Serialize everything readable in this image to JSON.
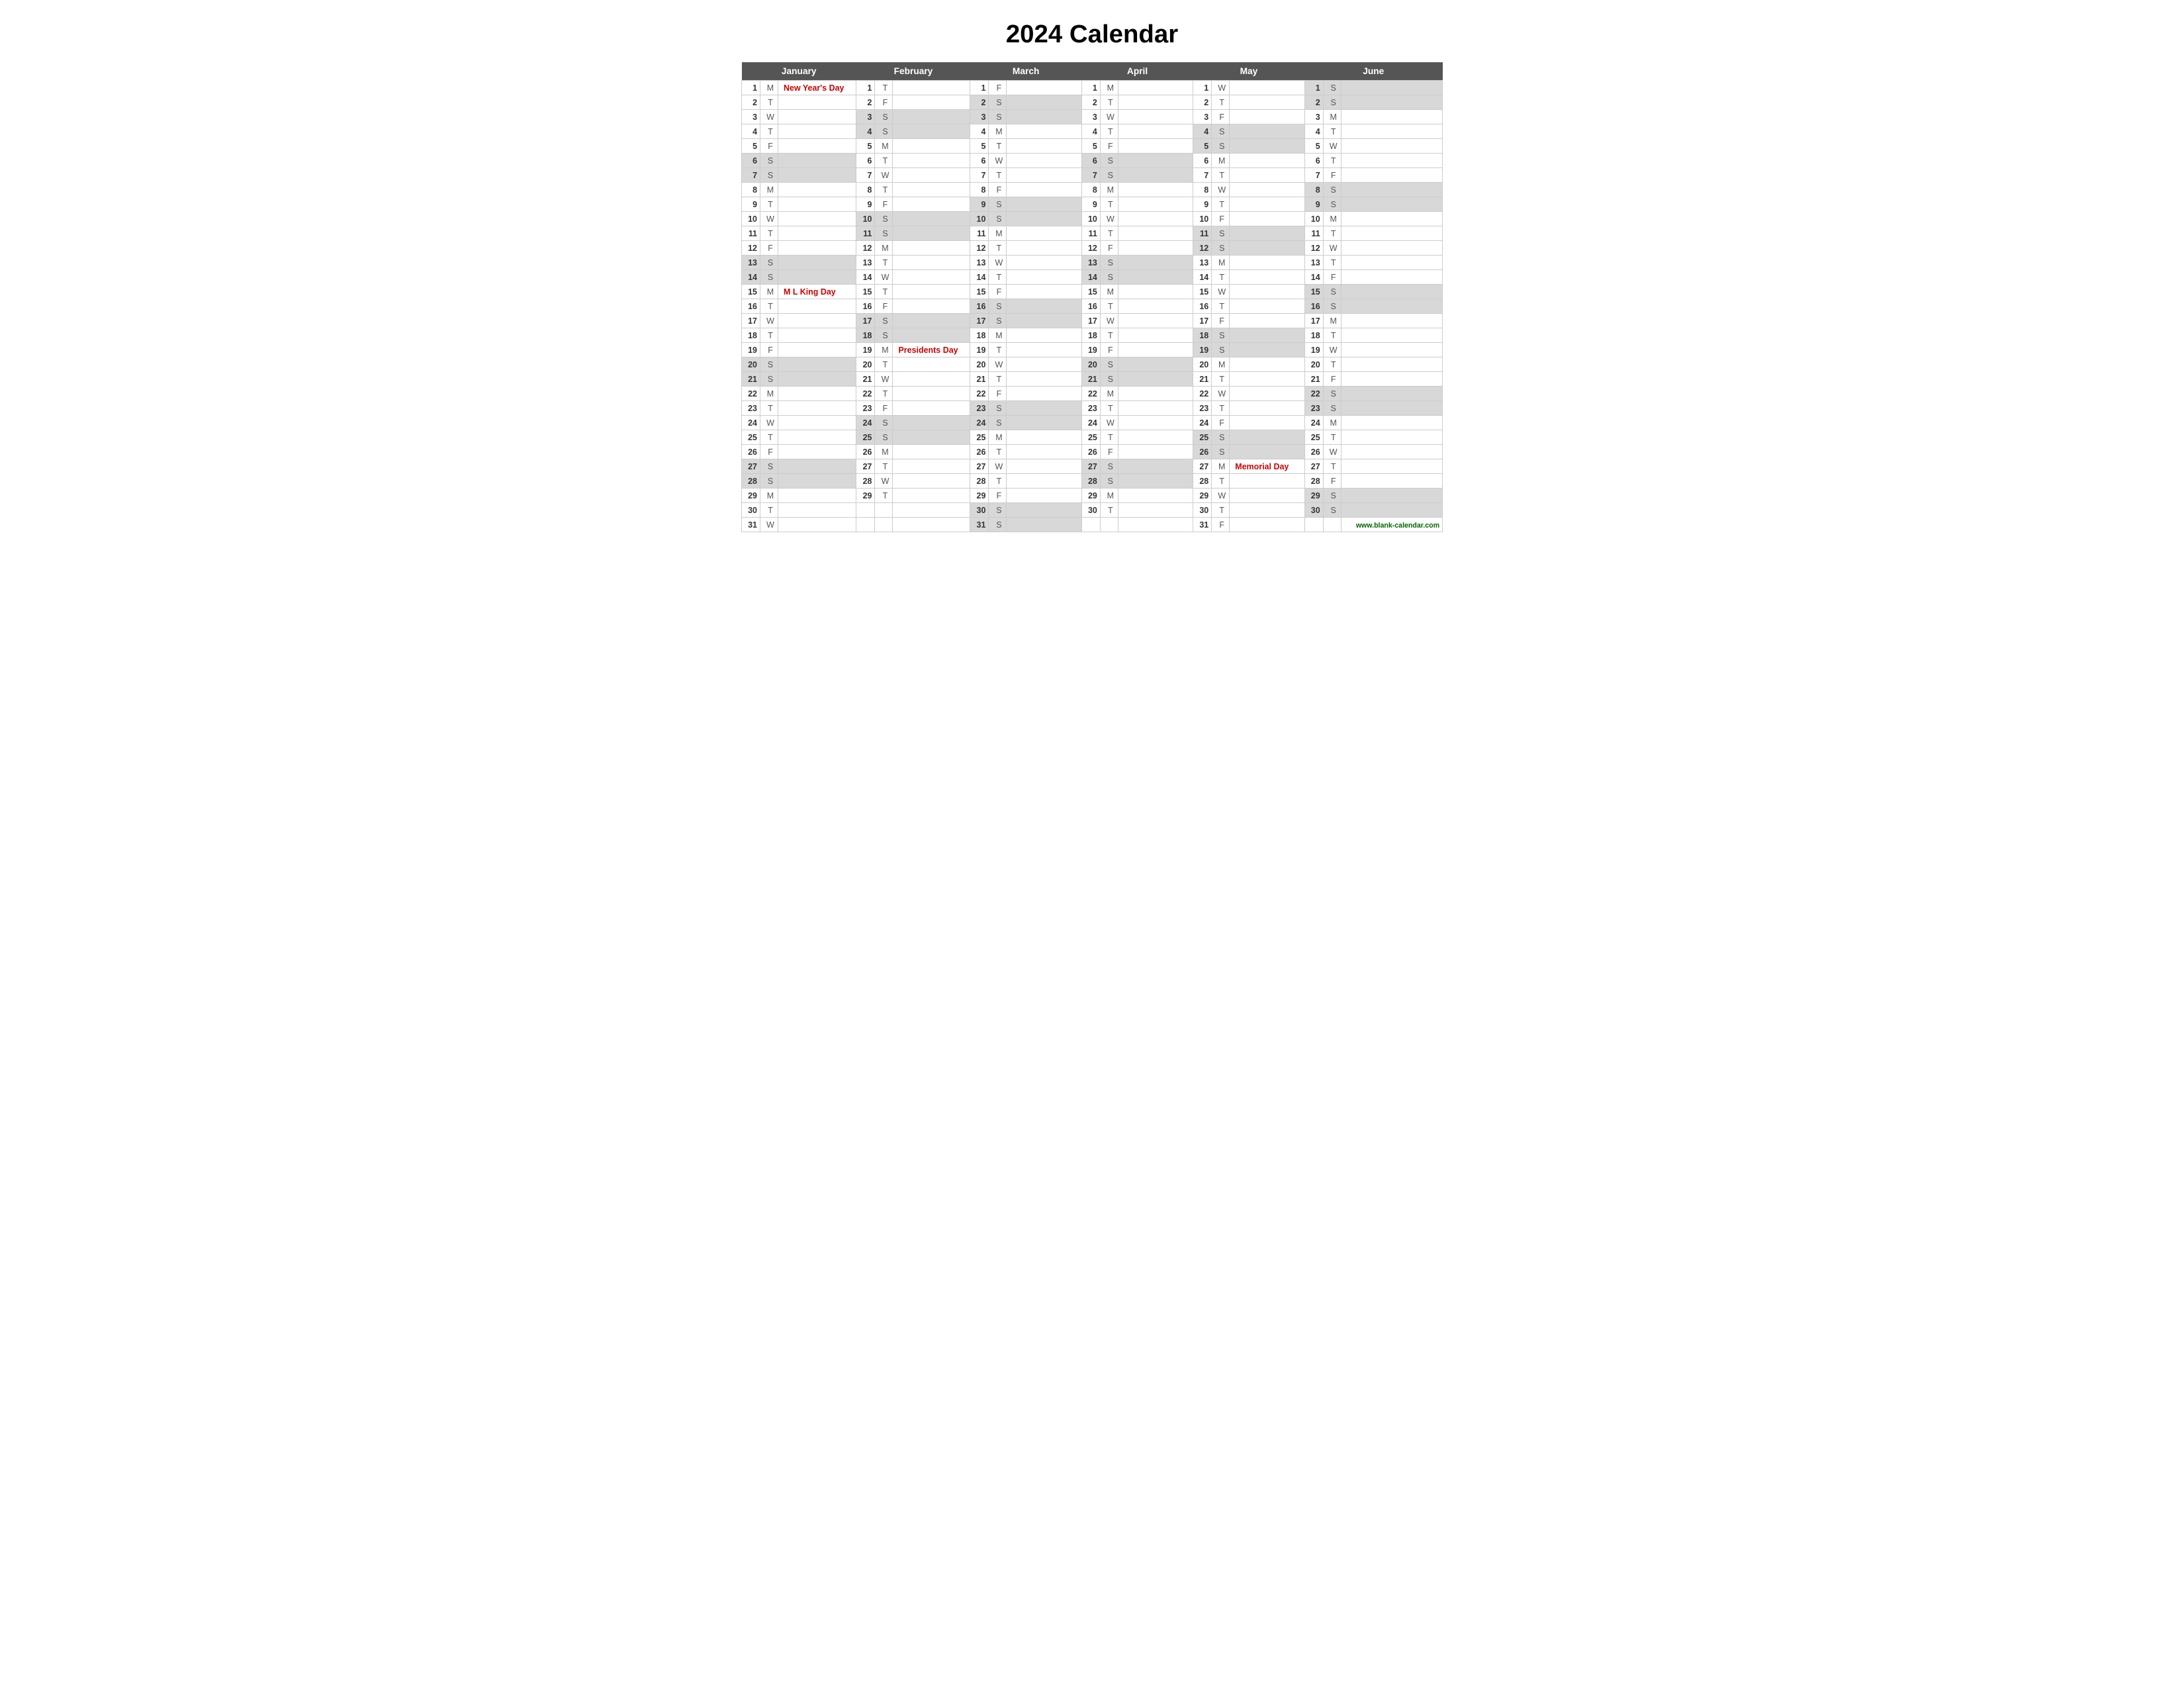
{
  "title": "2024 Calendar",
  "months": [
    "January",
    "February",
    "March",
    "April",
    "May",
    "June"
  ],
  "footer_url": "www.blank-calendar.com",
  "days": {
    "january": [
      {
        "d": 1,
        "l": "M",
        "h": "New Year's Day",
        "w": false
      },
      {
        "d": 2,
        "l": "T",
        "h": "",
        "w": false
      },
      {
        "d": 3,
        "l": "W",
        "h": "",
        "w": false
      },
      {
        "d": 4,
        "l": "T",
        "h": "",
        "w": false
      },
      {
        "d": 5,
        "l": "F",
        "h": "",
        "w": false
      },
      {
        "d": 6,
        "l": "S",
        "h": "",
        "w": true
      },
      {
        "d": 7,
        "l": "S",
        "h": "",
        "w": true
      },
      {
        "d": 8,
        "l": "M",
        "h": "",
        "w": false
      },
      {
        "d": 9,
        "l": "T",
        "h": "",
        "w": false
      },
      {
        "d": 10,
        "l": "W",
        "h": "",
        "w": false
      },
      {
        "d": 11,
        "l": "T",
        "h": "",
        "w": false
      },
      {
        "d": 12,
        "l": "F",
        "h": "",
        "w": false
      },
      {
        "d": 13,
        "l": "S",
        "h": "",
        "w": true
      },
      {
        "d": 14,
        "l": "S",
        "h": "",
        "w": true
      },
      {
        "d": 15,
        "l": "M",
        "h": "M L King Day",
        "w": false
      },
      {
        "d": 16,
        "l": "T",
        "h": "",
        "w": false
      },
      {
        "d": 17,
        "l": "W",
        "h": "",
        "w": false
      },
      {
        "d": 18,
        "l": "T",
        "h": "",
        "w": false
      },
      {
        "d": 19,
        "l": "F",
        "h": "",
        "w": false
      },
      {
        "d": 20,
        "l": "S",
        "h": "",
        "w": true
      },
      {
        "d": 21,
        "l": "S",
        "h": "",
        "w": true
      },
      {
        "d": 22,
        "l": "M",
        "h": "",
        "w": false
      },
      {
        "d": 23,
        "l": "T",
        "h": "",
        "w": false
      },
      {
        "d": 24,
        "l": "W",
        "h": "",
        "w": false
      },
      {
        "d": 25,
        "l": "T",
        "h": "",
        "w": false
      },
      {
        "d": 26,
        "l": "F",
        "h": "",
        "w": false
      },
      {
        "d": 27,
        "l": "S",
        "h": "",
        "w": true
      },
      {
        "d": 28,
        "l": "S",
        "h": "",
        "w": true
      },
      {
        "d": 29,
        "l": "M",
        "h": "",
        "w": false
      },
      {
        "d": 30,
        "l": "T",
        "h": "",
        "w": false
      },
      {
        "d": 31,
        "l": "W",
        "h": "",
        "w": false
      }
    ],
    "february": [
      {
        "d": 1,
        "l": "T",
        "h": "",
        "w": false
      },
      {
        "d": 2,
        "l": "F",
        "h": "",
        "w": false
      },
      {
        "d": 3,
        "l": "S",
        "h": "",
        "w": true
      },
      {
        "d": 4,
        "l": "S",
        "h": "",
        "w": true
      },
      {
        "d": 5,
        "l": "M",
        "h": "",
        "w": false
      },
      {
        "d": 6,
        "l": "T",
        "h": "",
        "w": false
      },
      {
        "d": 7,
        "l": "W",
        "h": "",
        "w": false
      },
      {
        "d": 8,
        "l": "T",
        "h": "",
        "w": false
      },
      {
        "d": 9,
        "l": "F",
        "h": "",
        "w": false
      },
      {
        "d": 10,
        "l": "S",
        "h": "",
        "w": true
      },
      {
        "d": 11,
        "l": "S",
        "h": "",
        "w": true
      },
      {
        "d": 12,
        "l": "M",
        "h": "",
        "w": false
      },
      {
        "d": 13,
        "l": "T",
        "h": "",
        "w": false
      },
      {
        "d": 14,
        "l": "W",
        "h": "",
        "w": false
      },
      {
        "d": 15,
        "l": "T",
        "h": "",
        "w": false
      },
      {
        "d": 16,
        "l": "F",
        "h": "",
        "w": false
      },
      {
        "d": 17,
        "l": "S",
        "h": "",
        "w": true
      },
      {
        "d": 18,
        "l": "S",
        "h": "",
        "w": true
      },
      {
        "d": 19,
        "l": "M",
        "h": "Presidents Day",
        "w": false
      },
      {
        "d": 20,
        "l": "T",
        "h": "",
        "w": false
      },
      {
        "d": 21,
        "l": "W",
        "h": "",
        "w": false
      },
      {
        "d": 22,
        "l": "T",
        "h": "",
        "w": false
      },
      {
        "d": 23,
        "l": "F",
        "h": "",
        "w": false
      },
      {
        "d": 24,
        "l": "S",
        "h": "",
        "w": true
      },
      {
        "d": 25,
        "l": "S",
        "h": "",
        "w": true
      },
      {
        "d": 26,
        "l": "M",
        "h": "",
        "w": false
      },
      {
        "d": 27,
        "l": "T",
        "h": "",
        "w": false
      },
      {
        "d": 28,
        "l": "W",
        "h": "",
        "w": false
      },
      {
        "d": 29,
        "l": "T",
        "h": "",
        "w": false
      }
    ],
    "march": [
      {
        "d": 1,
        "l": "F",
        "h": "",
        "w": false
      },
      {
        "d": 2,
        "l": "S",
        "h": "",
        "w": true
      },
      {
        "d": 3,
        "l": "S",
        "h": "",
        "w": true
      },
      {
        "d": 4,
        "l": "M",
        "h": "",
        "w": false
      },
      {
        "d": 5,
        "l": "T",
        "h": "",
        "w": false
      },
      {
        "d": 6,
        "l": "W",
        "h": "",
        "w": false
      },
      {
        "d": 7,
        "l": "T",
        "h": "",
        "w": false
      },
      {
        "d": 8,
        "l": "F",
        "h": "",
        "w": false
      },
      {
        "d": 9,
        "l": "S",
        "h": "",
        "w": true
      },
      {
        "d": 10,
        "l": "S",
        "h": "",
        "w": true
      },
      {
        "d": 11,
        "l": "M",
        "h": "",
        "w": false
      },
      {
        "d": 12,
        "l": "T",
        "h": "",
        "w": false
      },
      {
        "d": 13,
        "l": "W",
        "h": "",
        "w": false
      },
      {
        "d": 14,
        "l": "T",
        "h": "",
        "w": false
      },
      {
        "d": 15,
        "l": "F",
        "h": "",
        "w": false
      },
      {
        "d": 16,
        "l": "S",
        "h": "",
        "w": true
      },
      {
        "d": 17,
        "l": "S",
        "h": "",
        "w": true
      },
      {
        "d": 18,
        "l": "M",
        "h": "",
        "w": false
      },
      {
        "d": 19,
        "l": "T",
        "h": "",
        "w": false
      },
      {
        "d": 20,
        "l": "W",
        "h": "",
        "w": false
      },
      {
        "d": 21,
        "l": "T",
        "h": "",
        "w": false
      },
      {
        "d": 22,
        "l": "F",
        "h": "",
        "w": false
      },
      {
        "d": 23,
        "l": "S",
        "h": "",
        "w": true
      },
      {
        "d": 24,
        "l": "S",
        "h": "",
        "w": true
      },
      {
        "d": 25,
        "l": "M",
        "h": "",
        "w": false
      },
      {
        "d": 26,
        "l": "T",
        "h": "",
        "w": false
      },
      {
        "d": 27,
        "l": "W",
        "h": "",
        "w": false
      },
      {
        "d": 28,
        "l": "T",
        "h": "",
        "w": false
      },
      {
        "d": 29,
        "l": "F",
        "h": "",
        "w": false
      },
      {
        "d": 30,
        "l": "S",
        "h": "",
        "w": true
      },
      {
        "d": 31,
        "l": "S",
        "h": "",
        "w": true
      }
    ],
    "april": [
      {
        "d": 1,
        "l": "M",
        "h": "",
        "w": false
      },
      {
        "d": 2,
        "l": "T",
        "h": "",
        "w": false
      },
      {
        "d": 3,
        "l": "W",
        "h": "",
        "w": false
      },
      {
        "d": 4,
        "l": "T",
        "h": "",
        "w": false
      },
      {
        "d": 5,
        "l": "F",
        "h": "",
        "w": false
      },
      {
        "d": 6,
        "l": "S",
        "h": "",
        "w": true
      },
      {
        "d": 7,
        "l": "S",
        "h": "",
        "w": true
      },
      {
        "d": 8,
        "l": "M",
        "h": "",
        "w": false
      },
      {
        "d": 9,
        "l": "T",
        "h": "",
        "w": false
      },
      {
        "d": 10,
        "l": "W",
        "h": "",
        "w": false
      },
      {
        "d": 11,
        "l": "T",
        "h": "",
        "w": false
      },
      {
        "d": 12,
        "l": "F",
        "h": "",
        "w": false
      },
      {
        "d": 13,
        "l": "S",
        "h": "",
        "w": true
      },
      {
        "d": 14,
        "l": "S",
        "h": "",
        "w": true
      },
      {
        "d": 15,
        "l": "M",
        "h": "",
        "w": false
      },
      {
        "d": 16,
        "l": "T",
        "h": "",
        "w": false
      },
      {
        "d": 17,
        "l": "W",
        "h": "",
        "w": false
      },
      {
        "d": 18,
        "l": "T",
        "h": "",
        "w": false
      },
      {
        "d": 19,
        "l": "F",
        "h": "",
        "w": false
      },
      {
        "d": 20,
        "l": "S",
        "h": "",
        "w": true
      },
      {
        "d": 21,
        "l": "S",
        "h": "",
        "w": true
      },
      {
        "d": 22,
        "l": "M",
        "h": "",
        "w": false
      },
      {
        "d": 23,
        "l": "T",
        "h": "",
        "w": false
      },
      {
        "d": 24,
        "l": "W",
        "h": "",
        "w": false
      },
      {
        "d": 25,
        "l": "T",
        "h": "",
        "w": false
      },
      {
        "d": 26,
        "l": "F",
        "h": "",
        "w": false
      },
      {
        "d": 27,
        "l": "S",
        "h": "",
        "w": true
      },
      {
        "d": 28,
        "l": "S",
        "h": "",
        "w": true
      },
      {
        "d": 29,
        "l": "M",
        "h": "",
        "w": false
      },
      {
        "d": 30,
        "l": "T",
        "h": "",
        "w": false
      }
    ],
    "may": [
      {
        "d": 1,
        "l": "W",
        "h": "",
        "w": false
      },
      {
        "d": 2,
        "l": "T",
        "h": "",
        "w": false
      },
      {
        "d": 3,
        "l": "F",
        "h": "",
        "w": false
      },
      {
        "d": 4,
        "l": "S",
        "h": "",
        "w": true
      },
      {
        "d": 5,
        "l": "S",
        "h": "",
        "w": true
      },
      {
        "d": 6,
        "l": "M",
        "h": "",
        "w": false
      },
      {
        "d": 7,
        "l": "T",
        "h": "",
        "w": false
      },
      {
        "d": 8,
        "l": "W",
        "h": "",
        "w": false
      },
      {
        "d": 9,
        "l": "T",
        "h": "",
        "w": false
      },
      {
        "d": 10,
        "l": "F",
        "h": "",
        "w": false
      },
      {
        "d": 11,
        "l": "S",
        "h": "",
        "w": true
      },
      {
        "d": 12,
        "l": "S",
        "h": "",
        "w": true
      },
      {
        "d": 13,
        "l": "M",
        "h": "",
        "w": false
      },
      {
        "d": 14,
        "l": "T",
        "h": "",
        "w": false
      },
      {
        "d": 15,
        "l": "W",
        "h": "",
        "w": false
      },
      {
        "d": 16,
        "l": "T",
        "h": "",
        "w": false
      },
      {
        "d": 17,
        "l": "F",
        "h": "",
        "w": false
      },
      {
        "d": 18,
        "l": "S",
        "h": "",
        "w": true
      },
      {
        "d": 19,
        "l": "S",
        "h": "",
        "w": true
      },
      {
        "d": 20,
        "l": "M",
        "h": "",
        "w": false
      },
      {
        "d": 21,
        "l": "T",
        "h": "",
        "w": false
      },
      {
        "d": 22,
        "l": "W",
        "h": "",
        "w": false
      },
      {
        "d": 23,
        "l": "T",
        "h": "",
        "w": false
      },
      {
        "d": 24,
        "l": "F",
        "h": "",
        "w": false
      },
      {
        "d": 25,
        "l": "S",
        "h": "",
        "w": true
      },
      {
        "d": 26,
        "l": "S",
        "h": "",
        "w": true
      },
      {
        "d": 27,
        "l": "M",
        "h": "Memorial Day",
        "w": false
      },
      {
        "d": 28,
        "l": "T",
        "h": "",
        "w": false
      },
      {
        "d": 29,
        "l": "W",
        "h": "",
        "w": false
      },
      {
        "d": 30,
        "l": "T",
        "h": "",
        "w": false
      },
      {
        "d": 31,
        "l": "F",
        "h": "",
        "w": false
      }
    ],
    "june": [
      {
        "d": 1,
        "l": "S",
        "h": "",
        "w": true
      },
      {
        "d": 2,
        "l": "S",
        "h": "",
        "w": true
      },
      {
        "d": 3,
        "l": "M",
        "h": "",
        "w": false
      },
      {
        "d": 4,
        "l": "T",
        "h": "",
        "w": false
      },
      {
        "d": 5,
        "l": "W",
        "h": "",
        "w": false
      },
      {
        "d": 6,
        "l": "T",
        "h": "",
        "w": false
      },
      {
        "d": 7,
        "l": "F",
        "h": "",
        "w": false
      },
      {
        "d": 8,
        "l": "S",
        "h": "",
        "w": true
      },
      {
        "d": 9,
        "l": "S",
        "h": "",
        "w": true
      },
      {
        "d": 10,
        "l": "M",
        "h": "",
        "w": false
      },
      {
        "d": 11,
        "l": "T",
        "h": "",
        "w": false
      },
      {
        "d": 12,
        "l": "W",
        "h": "",
        "w": false
      },
      {
        "d": 13,
        "l": "T",
        "h": "",
        "w": false
      },
      {
        "d": 14,
        "l": "F",
        "h": "",
        "w": false
      },
      {
        "d": 15,
        "l": "S",
        "h": "",
        "w": true
      },
      {
        "d": 16,
        "l": "S",
        "h": "",
        "w": true
      },
      {
        "d": 17,
        "l": "M",
        "h": "",
        "w": false
      },
      {
        "d": 18,
        "l": "T",
        "h": "",
        "w": false
      },
      {
        "d": 19,
        "l": "W",
        "h": "",
        "w": false
      },
      {
        "d": 20,
        "l": "T",
        "h": "",
        "w": false
      },
      {
        "d": 21,
        "l": "F",
        "h": "",
        "w": false
      },
      {
        "d": 22,
        "l": "S",
        "h": "",
        "w": true
      },
      {
        "d": 23,
        "l": "S",
        "h": "",
        "w": true
      },
      {
        "d": 24,
        "l": "M",
        "h": "",
        "w": false
      },
      {
        "d": 25,
        "l": "T",
        "h": "",
        "w": false
      },
      {
        "d": 26,
        "l": "W",
        "h": "",
        "w": false
      },
      {
        "d": 27,
        "l": "T",
        "h": "",
        "w": false
      },
      {
        "d": 28,
        "l": "F",
        "h": "",
        "w": false
      },
      {
        "d": 29,
        "l": "S",
        "h": "",
        "w": true
      },
      {
        "d": 30,
        "l": "S",
        "h": "",
        "w": true
      }
    ]
  }
}
